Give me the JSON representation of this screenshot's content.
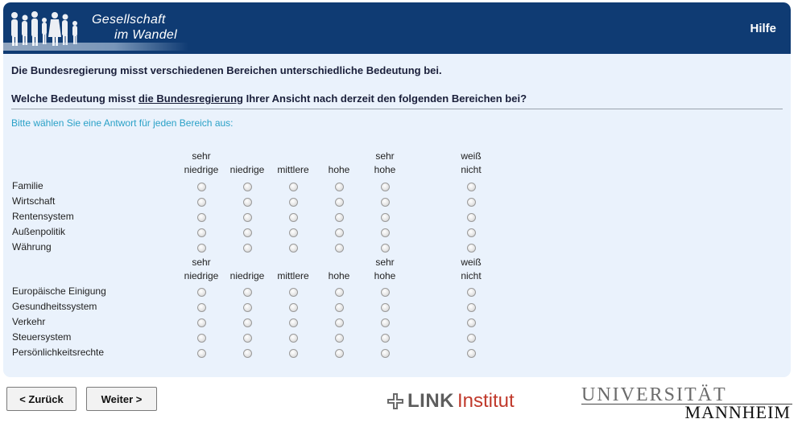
{
  "header": {
    "brand_line1": "Gesellschaft",
    "brand_line2": "im Wandel",
    "help_label": "Hilfe"
  },
  "intro": "Die Bundesregierung misst verschiedenen Bereichen unterschiedliche Bedeutung bei.",
  "question": {
    "before": "Welche Bedeutung misst ",
    "underlined": "die Bundesregierung",
    "after": " Ihrer Ansicht nach derzeit den folgenden Bereichen bei?"
  },
  "instruction": "Bitte wählen Sie eine Antwort für jeden Bereich aus:",
  "columns": [
    {
      "line1": "sehr",
      "line2": "niedrige"
    },
    {
      "line1": "",
      "line2": "niedrige"
    },
    {
      "line1": "",
      "line2": "mittlere"
    },
    {
      "line1": "",
      "line2": "hohe"
    },
    {
      "line1": "sehr",
      "line2": "hohe"
    },
    {
      "line1": "weiß",
      "line2": "nicht"
    }
  ],
  "group1": [
    "Familie",
    "Wirtschaft",
    "Rentensystem",
    "Außenpolitik",
    "Währung"
  ],
  "group2": [
    "Europäische Einigung",
    "Gesundheitssystem",
    "Verkehr",
    "Steuersystem",
    "Persönlichkeitsrechte"
  ],
  "buttons": {
    "back": "< Zurück",
    "next": "Weiter >"
  },
  "logos": {
    "link_word": "LINK",
    "link_institut": "Institut",
    "uni_line1": "UNIVERSITÄT",
    "uni_line2": "MANNHEIM"
  }
}
